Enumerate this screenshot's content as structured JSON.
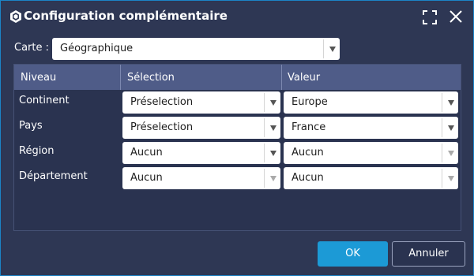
{
  "dialog": {
    "title": "Configuration complémentaire"
  },
  "carte": {
    "label": "Carte :",
    "value": "Géographique"
  },
  "grid": {
    "columns": [
      "Niveau",
      "Sélection",
      "Valeur"
    ],
    "rows": [
      {
        "niveau": "Continent",
        "selection": "Préselection",
        "valeur": "Europe"
      },
      {
        "niveau": "Pays",
        "selection": "Préselection",
        "valeur": "France"
      },
      {
        "niveau": "Région",
        "selection": "Aucun",
        "valeur": "Aucun"
      },
      {
        "niveau": "Département",
        "selection": "Aucun",
        "valeur": "Aucun"
      }
    ]
  },
  "buttons": {
    "ok": "OK",
    "cancel": "Annuler"
  },
  "colors": {
    "background": "#2e3754",
    "header": "#4f5c88",
    "accent": "#1c9ad6"
  },
  "icons": {
    "title": "app-logo-icon",
    "maximize": "maximize-icon",
    "close": "close-icon",
    "dropdown": "chevron-down-icon"
  }
}
